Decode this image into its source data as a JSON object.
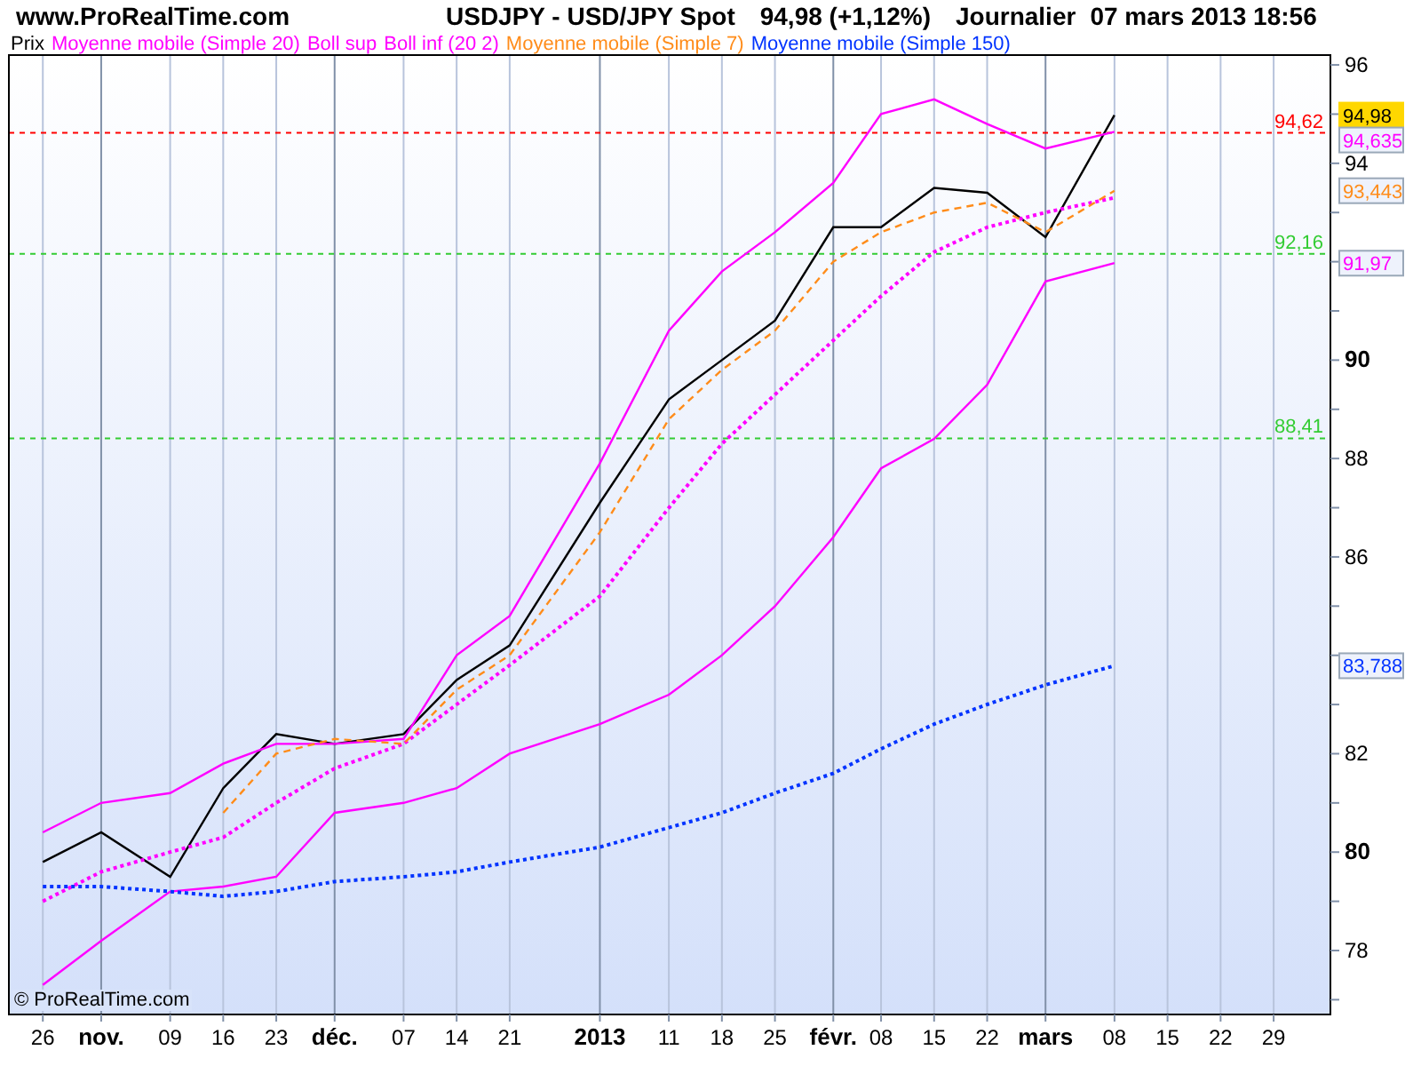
{
  "header": {
    "site": "www.ProRealTime.com",
    "instrument": "USDJPY - USD/JPY Spot",
    "quote": "94,98 (+1,12%)",
    "period": "Journalier",
    "datetime": "07 mars 2013 18:56"
  },
  "copyright": "© ProRealTime.com",
  "chart_data": {
    "type": "line",
    "categories": [
      "26",
      "nov.",
      "09",
      "16",
      "23",
      "déc.",
      "07",
      "14",
      "21",
      "2013",
      "11",
      "18",
      "25",
      "févr.",
      "08",
      "15",
      "22",
      "mars",
      "08",
      "15",
      "22",
      "29"
    ],
    "series": [
      {
        "name": "Prix",
        "color": "#000000",
        "line_style": "solid",
        "values": [
          79.8,
          80.4,
          79.5,
          81.3,
          82.4,
          82.2,
          82.4,
          83.5,
          84.2,
          87.1,
          89.2,
          90.0,
          90.8,
          92.7,
          92.7,
          93.5,
          93.4,
          92.5,
          94.98,
          null,
          null,
          null
        ]
      },
      {
        "name": "Moyenne mobile (Simple 20)",
        "color": "#ff00ff",
        "line_style": "dotted",
        "values": [
          79.0,
          79.6,
          80.0,
          80.3,
          81.0,
          81.7,
          82.2,
          83.0,
          83.8,
          85.2,
          87.0,
          88.3,
          89.3,
          90.4,
          91.3,
          92.2,
          92.7,
          93.0,
          93.3,
          null,
          null,
          null
        ]
      },
      {
        "name": "Boll sup",
        "color": "#ff00ff",
        "line_style": "solid",
        "values": [
          80.4,
          81.0,
          81.2,
          81.8,
          82.2,
          82.2,
          82.3,
          84.0,
          84.8,
          87.9,
          90.6,
          91.8,
          92.6,
          93.6,
          95.0,
          95.3,
          94.8,
          94.3,
          94.64,
          null,
          null,
          null
        ]
      },
      {
        "name": "Boll inf (20 2)",
        "color": "#ff00ff",
        "line_style": "solid",
        "values": [
          77.3,
          78.2,
          79.2,
          79.3,
          79.5,
          80.8,
          81.0,
          81.3,
          82.0,
          82.6,
          83.2,
          84.0,
          85.0,
          86.4,
          87.8,
          88.4,
          89.5,
          91.6,
          91.97,
          null,
          null,
          null
        ]
      },
      {
        "name": "Moyenne mobile (Simple 7)",
        "color": "#ff8c1a",
        "line_style": "dashed",
        "values": [
          null,
          null,
          null,
          80.8,
          82.0,
          82.3,
          82.2,
          83.3,
          84.0,
          86.5,
          88.8,
          89.8,
          90.6,
          92.0,
          92.6,
          93.0,
          93.2,
          92.6,
          93.44,
          null,
          null,
          null
        ]
      },
      {
        "name": "Moyenne mobile (Simple 150)",
        "color": "#0033ff",
        "line_style": "dotted",
        "values": [
          79.3,
          79.3,
          79.2,
          79.1,
          79.2,
          79.4,
          79.5,
          79.6,
          79.8,
          80.1,
          80.5,
          80.8,
          81.2,
          81.6,
          82.1,
          82.6,
          83.0,
          83.4,
          83.79,
          null,
          null,
          null
        ]
      }
    ],
    "ylim": [
      76.7,
      96.2
    ],
    "grid": true,
    "yticks": [
      78,
      80,
      82,
      86,
      88,
      90,
      94,
      96
    ],
    "ref_lines": [
      {
        "axis": "y",
        "value": 94.62,
        "label": "94,62",
        "color": "#ff0000"
      },
      {
        "axis": "y",
        "value": 92.16,
        "label": "92,16",
        "color": "#33cc33"
      },
      {
        "axis": "y",
        "value": 88.41,
        "label": "88,41",
        "color": "#33cc33"
      }
    ],
    "annotations": [
      "94,98",
      "94,635",
      "93,443",
      "91,97",
      "83,788"
    ]
  }
}
